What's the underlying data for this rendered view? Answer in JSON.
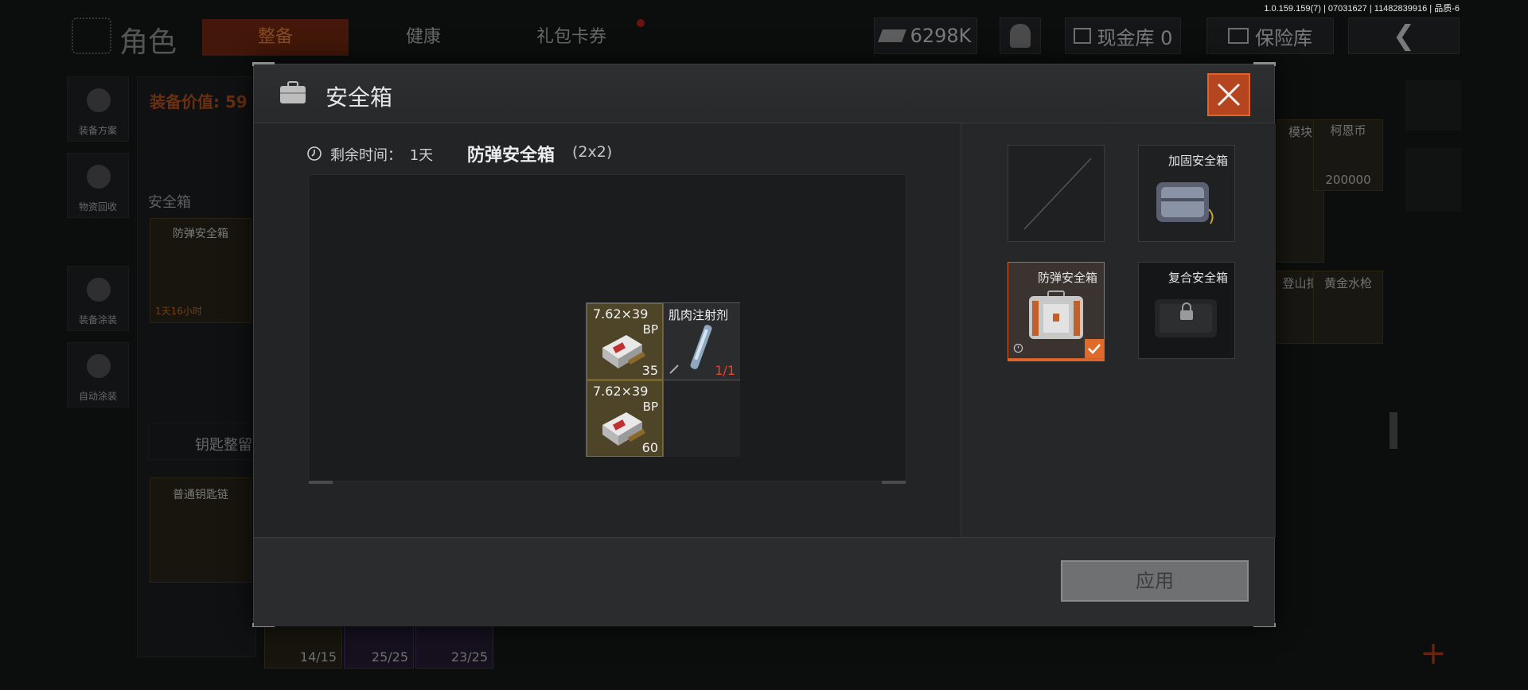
{
  "version": "1.0.159.159(7) | 07031627 | 11482839916 | 品质-6",
  "background": {
    "page_title": "角色",
    "tabs": [
      {
        "label": "整备",
        "active": true
      },
      {
        "label": "健康",
        "active": false
      },
      {
        "label": "礼包卡券",
        "active": false
      }
    ],
    "currency": "6298K",
    "cash_vault": "现金库 0",
    "insurance_vault": "保险库",
    "side_buttons": [
      "装备方案",
      "物资回收",
      "装备涂装",
      "自动涂装"
    ],
    "equipment_value_label": "装备价值: 59",
    "secure_case_label": "安全箱",
    "secure_case_slot_label": "防弹安全箱",
    "secure_case_slot_timer": "1天16小时",
    "key_section_label": "钥匙整留",
    "keychain_label": "普通钥匙链",
    "bottom_counts": [
      "14/15",
      "25/25",
      "23/25"
    ],
    "right_cards": [
      {
        "label": "模块"
      },
      {
        "label": "柯恩币",
        "value": "200000"
      },
      {
        "label": "登山扣"
      },
      {
        "label": "黄金水枪"
      }
    ]
  },
  "modal": {
    "title": "安全箱",
    "timer_label": "剩余时间：",
    "timer_value": "1天",
    "case_name": "防弹安全箱",
    "case_size": "(2x2)",
    "items": [
      {
        "name": "7.62×39",
        "subtype": "BP",
        "count": "35",
        "kind": "ammo"
      },
      {
        "name": "肌肉注射剂",
        "count": "1/1",
        "kind": "med"
      },
      {
        "name": "7.62×39",
        "subtype": "BP",
        "count": "60",
        "kind": "ammo"
      }
    ],
    "case_options": [
      {
        "label": "",
        "state": "empty"
      },
      {
        "label": "加固安全箱",
        "state": "available"
      },
      {
        "label": "防弹安全箱",
        "state": "selected"
      },
      {
        "label": "复合安全箱",
        "state": "locked"
      }
    ],
    "apply_label": "应用"
  },
  "colors": {
    "accent": "#e0642c",
    "close_bg": "#b4451f",
    "ammo_cell": "#4e4428",
    "count_red": "#e0452a"
  }
}
